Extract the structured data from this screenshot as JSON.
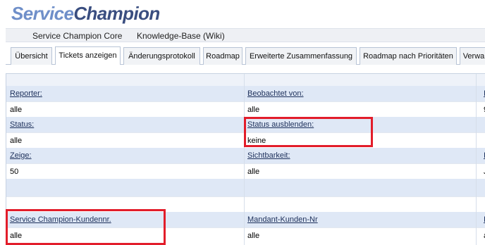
{
  "logo": {
    "part1": "Service",
    "part2": "Champion"
  },
  "project_bar": {
    "links": [
      "Service Champion Core",
      "Knowledge-Base (Wiki)"
    ]
  },
  "tabs": [
    {
      "label": "Übersicht",
      "active": false
    },
    {
      "label": "Tickets anzeigen",
      "active": true
    },
    {
      "label": "Änderungsprotokoll",
      "active": false
    },
    {
      "label": "Roadmap",
      "active": false
    },
    {
      "label": "Erweiterte Zusammenfassung",
      "active": false
    },
    {
      "label": "Roadmap nach Prioritäten",
      "active": false
    },
    {
      "label": "Verwa",
      "active": false
    }
  ],
  "filters": {
    "reporter": {
      "label": "Reporter:",
      "value": "alle"
    },
    "beobachtet_von": {
      "label": "Beobachtet von:",
      "value": "alle"
    },
    "status": {
      "label": "Status:",
      "value": "alle"
    },
    "status_ausblenden": {
      "label": "Status ausblenden:",
      "value": "keine"
    },
    "zeige": {
      "label": "Zeige:",
      "value": "50"
    },
    "sichtbarkeit": {
      "label": "Sichtbarkeit:",
      "value": "alle"
    },
    "kundennr": {
      "label": "Service Champion-Kundennr.",
      "value": "alle"
    },
    "mandant_kunden_nr": {
      "label": "Mandant-Kunden-Nr",
      "value": "alle"
    },
    "col3_row1_value": "9",
    "col3_row3_value": "J",
    "col3_row5_value": "a"
  },
  "highlight_color": "#e21d2a"
}
